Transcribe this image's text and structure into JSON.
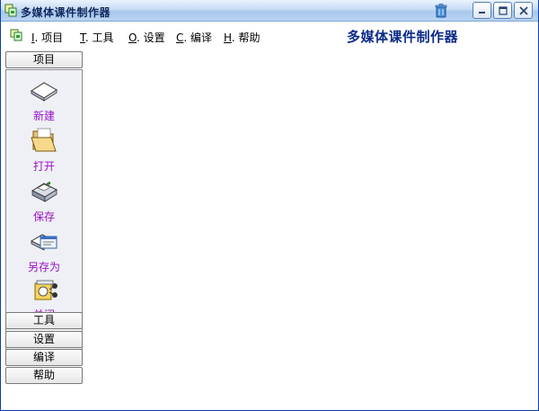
{
  "window": {
    "title": "多媒体课件制作器"
  },
  "menu": {
    "items": [
      {
        "key": "I",
        "label": ". 项目"
      },
      {
        "key": "T",
        "label": ". 工具"
      },
      {
        "key": "O",
        "label": ". 设置"
      },
      {
        "key": "C",
        "label": ". 编译"
      },
      {
        "key": "H",
        "label": ". 帮助"
      }
    ],
    "brand": "多媒体课件制作器"
  },
  "sidebar": {
    "categories": [
      {
        "label": "项目"
      },
      {
        "label": "工具"
      },
      {
        "label": "设置"
      },
      {
        "label": "编译"
      },
      {
        "label": "帮助"
      }
    ],
    "tools": [
      {
        "label": "新建",
        "icon": "new-document-icon"
      },
      {
        "label": "打开",
        "icon": "open-folder-icon"
      },
      {
        "label": "保存",
        "icon": "save-icon"
      },
      {
        "label": "另存为",
        "icon": "save-as-icon"
      },
      {
        "label": "关闭",
        "icon": "close-icon"
      }
    ]
  },
  "colors": {
    "brand": "#0b2a8a",
    "tool_label": "#9b10c9",
    "title_bar": "#b8d3f1"
  }
}
